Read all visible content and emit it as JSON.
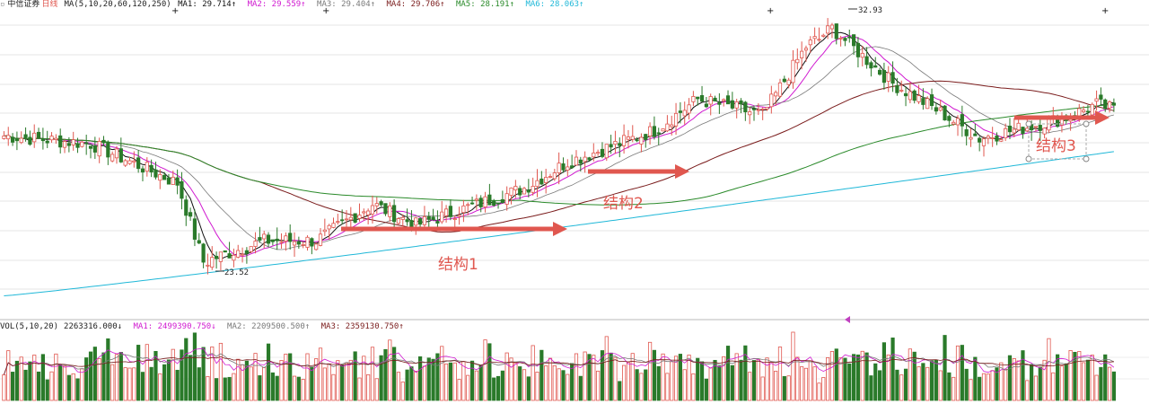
{
  "header": {
    "stock_name": "中信证券",
    "period": "日线",
    "ma_spec": "MA(5,10,20,60,120,250)",
    "ma_values": [
      {
        "label": "MA1:",
        "value": "29.714↑",
        "color": "#111111"
      },
      {
        "label": "MA2:",
        "value": "29.559↑",
        "color": "#d01ad0"
      },
      {
        "label": "MA3:",
        "value": "29.404↑",
        "color": "#7a7a7a"
      },
      {
        "label": "MA4:",
        "value": "29.706↑",
        "color": "#7a1c1c"
      },
      {
        "label": "MA5:",
        "value": "28.191↑",
        "color": "#2a8a2a"
      },
      {
        "label": "MA6:",
        "value": "28.063↑",
        "color": "#20b8d8"
      }
    ]
  },
  "volume_header": {
    "spec": "VOL(5,10,20)",
    "vol_value": "2263316.000↓",
    "ma_values": [
      {
        "label": "MA1:",
        "value": "2499390.750↓",
        "color": "#d01ad0"
      },
      {
        "label": "MA2:",
        "value": "2209500.500↑",
        "color": "#7a7a7a"
      },
      {
        "label": "MA3:",
        "value": "2359130.750↑",
        "color": "#7a1c1c"
      }
    ]
  },
  "annotations": {
    "low_label": "23.52",
    "high_label": "32.93",
    "structure_1": "结构1",
    "structure_2": "结构2",
    "structure_3": "结构3"
  },
  "colors": {
    "up": "#e0574f",
    "down": "#2a7a2a",
    "arrow": "#e0574f",
    "ma5": "#111111",
    "ma10": "#d01ad0",
    "ma20": "#7a7a7a",
    "ma60": "#7a1c1c",
    "ma120": "#2a8a2a",
    "ma250": "#20b8d8"
  },
  "chart_data": {
    "type": "candlestick",
    "y_range": [
      22.0,
      33.5
    ],
    "price_key_points": [
      [
        0,
        28.8
      ],
      [
        20,
        28.5
      ],
      [
        40,
        27.0
      ],
      [
        46,
        24.0
      ],
      [
        60,
        24.8
      ],
      [
        72,
        24.8
      ],
      [
        85,
        26.2
      ],
      [
        95,
        25.4
      ],
      [
        120,
        26.8
      ],
      [
        130,
        27.8
      ],
      [
        150,
        29.0
      ],
      [
        160,
        30.2
      ],
      [
        175,
        29.6
      ],
      [
        185,
        32.2
      ],
      [
        191,
        32.9
      ],
      [
        205,
        30.8
      ],
      [
        215,
        29.8
      ],
      [
        225,
        28.7
      ],
      [
        235,
        29.1
      ],
      [
        245,
        29.5
      ],
      [
        252,
        30.0
      ],
      [
        256,
        29.8
      ]
    ],
    "low_point": {
      "index": 47,
      "price": 23.52
    },
    "high_point": {
      "index": 188,
      "price": 32.93
    },
    "ma250_range": [
      22.7,
      28.2
    ],
    "ma120_range": [
      27.3,
      28.2
    ],
    "ma60_range": [
      29.2,
      29.7
    ]
  }
}
